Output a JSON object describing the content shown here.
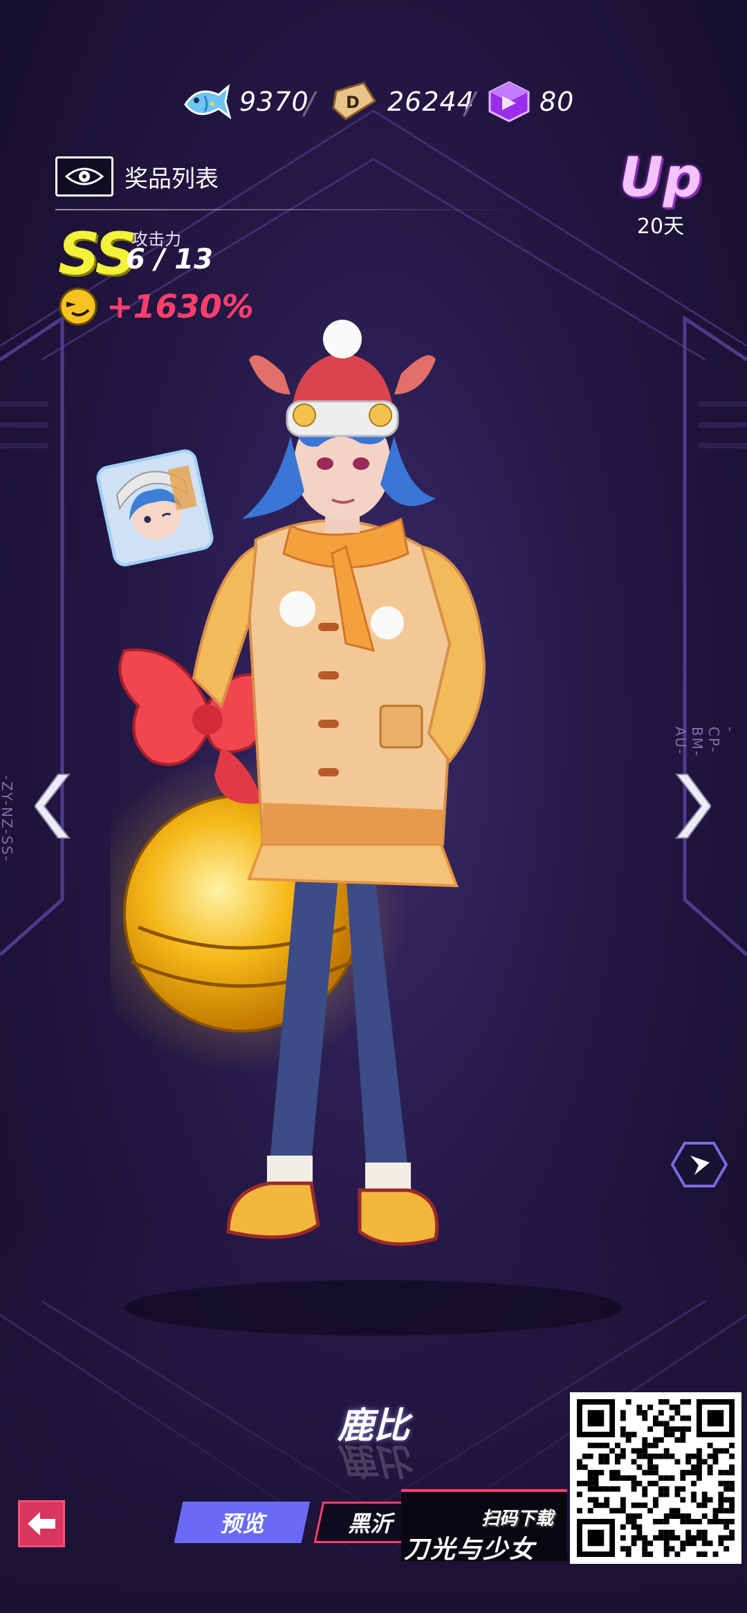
{
  "currencies": [
    {
      "icon": "fish-icon",
      "value": "9370"
    },
    {
      "icon": "d-coin-icon",
      "value": "26244"
    },
    {
      "icon": "purple-cube-icon",
      "value": "80"
    }
  ],
  "prize_list": {
    "label": "奖品列表",
    "icon": "eye-icon"
  },
  "stats": {
    "rank": "SS",
    "attack_label": "攻击力",
    "attack_value": "6 / 13",
    "bonus": "+1630%"
  },
  "up_badge": {
    "text": "Up",
    "days": "20天"
  },
  "side_labels": {
    "left": "-ZY-NZ-SS-",
    "right": "-CP-BM-AU-"
  },
  "character_name": "鹿比",
  "bottom": {
    "tab_preview": "预览",
    "tab_other": "黑沂",
    "download_text": "扫码下载",
    "game_title": "刀光与少女"
  },
  "colors": {
    "accent_pink": "#ff3f6b",
    "accent_blue": "#6b6af4",
    "rank_yellow": "#f2f23a"
  }
}
